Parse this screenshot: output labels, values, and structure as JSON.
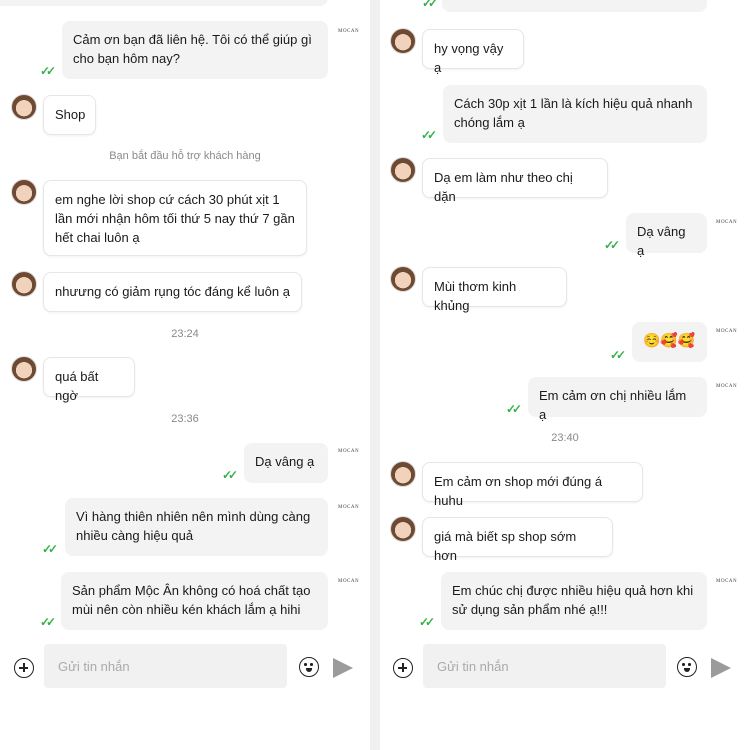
{
  "brand_mark": "MOCAN",
  "left": {
    "msg1": "Cảm ơn bạn đã liên hệ. Tôi có thể giúp gì cho bạn hôm nay?",
    "msg2": "Shop",
    "system_notice": "Bạn bắt đầu hỗ trợ khách hàng",
    "msg3": "em nghe lời shop cứ cách 30 phút xịt 1 lần mới nhận hôm tối thứ 5 nay thứ 7 gần hết chai luôn ạ",
    "msg4": "nhưưng có giảm rụng tóc đáng kể luôn ạ",
    "time1": "23:24",
    "msg5": "quá bất ngờ",
    "time2": "23:36",
    "msg6": "Dạ vâng ạ",
    "msg7": "Vì hàng thiên nhiên nên mình dùng càng nhiều càng hiệu quả",
    "msg8": "Sản phẩm Mộc Ân không có hoá chất tạo mùi nên còn nhiều kén khách lắm ạ hihi"
  },
  "right": {
    "msg1": "hy vọng vậy ạ",
    "msg2": "Cách 30p xịt 1 lần là kích hiệu quả nhanh chóng lắm ạ",
    "msg3": "Dạ em làm như theo chị dặn",
    "msg4": "Dạ vâng ạ",
    "msg5": "Mùi thơm kinh khủng",
    "msg6": "☺️🥰🥰",
    "msg7": "Em cảm ơn chị nhiều lắm ạ",
    "time1": "23:40",
    "msg8": "Em cảm ơn shop mới đúng á huhu",
    "msg9": "giá mà biết sp shop sớm hơn",
    "msg10": "Em chúc chị được nhiều hiệu quả hơn khi sử dụng sản phẩm nhé ạ!!!"
  },
  "input": {
    "placeholder": "Gửi tin nhắn"
  },
  "icons": {
    "add": "plus-circle-icon",
    "emoji": "emoji-icon",
    "send": "send-icon",
    "read": "double-check-icon"
  },
  "colors": {
    "check": "#35b24a",
    "outgoing_bg": "#f3f3f3",
    "incoming_bg": "#ffffff"
  }
}
